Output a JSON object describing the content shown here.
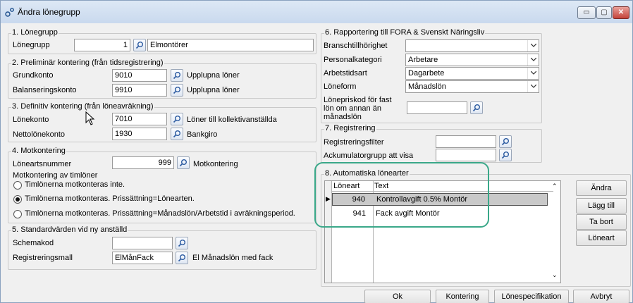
{
  "window": {
    "title": "Ändra lönegrupp"
  },
  "group1": {
    "legend": "1. Lönegrupp",
    "label": "Lönegrupp",
    "value": "1",
    "name": "Elmontörer"
  },
  "group2": {
    "legend": "2. Preliminär kontering (från tidsregistrering)",
    "grund_label": "Grundkonto",
    "grund_value": "9010",
    "grund_desc": "Upplupna löner",
    "balans_label": "Balanseringskonto",
    "balans_value": "9910",
    "balans_desc": "Upplupna löner"
  },
  "group3": {
    "legend": "3. Definitiv kontering (från löneavräkning)",
    "lone_label": "Lönekonto",
    "lone_value": "7010",
    "lone_desc": "Löner till kollektivanställda",
    "netto_label": "Nettolönekonto",
    "netto_value": "1930",
    "netto_desc": "Bankgiro"
  },
  "group4": {
    "legend": "4. Motkontering",
    "loneart_label": "Löneartsnummer",
    "loneart_value": "999",
    "loneart_desc": "Motkontering",
    "tim_heading": "Motkontering av timlöner",
    "options": [
      "Timlönerna motkonteras inte.",
      "Timlönerna motkonteras. Prissättning=Lönearten.",
      "Timlönerna motkonteras. Prissättning=Månadslön/Arbetstid i avräkningsperiod."
    ],
    "selected_index": 1
  },
  "group5": {
    "legend": "5. Standardvärden vid ny anställd",
    "schema_label": "Schemakod",
    "schema_value": "",
    "reg_label": "Registreringsmall",
    "reg_value": "ElMånFack",
    "reg_desc": "El Månadslön med fack"
  },
  "group6": {
    "legend": "6. Rapportering till FORA & Svenskt Näringsliv",
    "bransch_label": "Branschtillhörighet",
    "bransch_value": "",
    "personal_label": "Personalkategori",
    "personal_value": "Arbetare",
    "arbetstid_label": "Arbetstidsart",
    "arbetstid_value": "Dagarbete",
    "loneform_label": "Löneform",
    "loneform_value": "Månadslön",
    "lonepriskod_label_1": "Lönepriskod för fast",
    "lonepriskod_label_2": "lön om annan än",
    "lonepriskod_label_3": "månadslön",
    "lonepriskod_value": ""
  },
  "group7": {
    "legend": "7. Registrering",
    "filter_label": "Registreringsfilter",
    "filter_value": "",
    "ack_label": "Ackumulatorgrupp att visa",
    "ack_value": ""
  },
  "group8": {
    "legend": "8. Automatiska lönearter",
    "columns": [
      "Löneart",
      "Text"
    ],
    "rows": [
      {
        "loneart": "940",
        "text": "Kontrollavgift 0.5% Montör"
      },
      {
        "loneart": "941",
        "text": "Fack avgift Montör"
      }
    ],
    "side_buttons": [
      "Ändra",
      "Lägg till",
      "Ta bort",
      "Löneart"
    ]
  },
  "footer": {
    "buttons": [
      "Ok",
      "Kontering",
      "Lönespecifikation",
      "Avbryt"
    ]
  },
  "colors": {
    "highlight_ring": "#3aa889",
    "selected_row": "#c9c9c9"
  }
}
